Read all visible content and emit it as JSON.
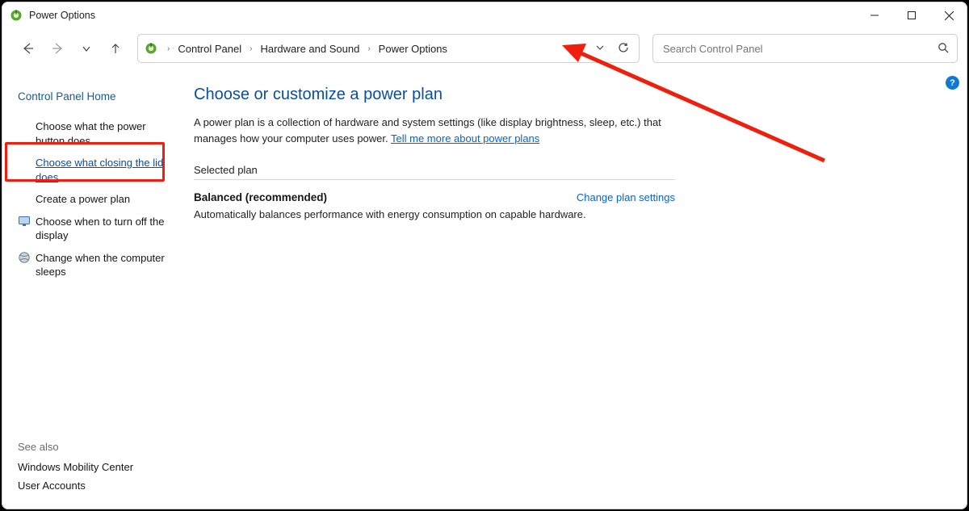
{
  "window": {
    "title": "Power Options"
  },
  "breadcrumb": {
    "items": [
      "Control Panel",
      "Hardware and Sound",
      "Power Options"
    ]
  },
  "search": {
    "placeholder": "Search Control Panel"
  },
  "sidebar": {
    "home": "Control Panel Home",
    "links": [
      {
        "label": "Choose what the power button does",
        "active": false
      },
      {
        "label": "Choose what closing the lid does",
        "active": true
      },
      {
        "label": "Create a power plan",
        "active": false
      },
      {
        "label": "Choose when to turn off the display",
        "active": false,
        "icon": "monitor"
      },
      {
        "label": "Change when the computer sleeps",
        "active": false,
        "icon": "globe"
      }
    ],
    "see_also_title": "See also",
    "see_also": [
      "Windows Mobility Center",
      "User Accounts"
    ]
  },
  "main": {
    "heading": "Choose or customize a power plan",
    "intro_prefix": "A power plan is a collection of hardware and system settings (like display brightness, sleep, etc.) that manages how your computer uses power. ",
    "intro_link": "Tell me more about power plans",
    "section_label": "Selected plan",
    "plan_name": "Balanced (recommended)",
    "plan_settings_link": "Change plan settings",
    "plan_desc": "Automatically balances performance with energy consumption on capable hardware."
  },
  "help_badge": "?"
}
